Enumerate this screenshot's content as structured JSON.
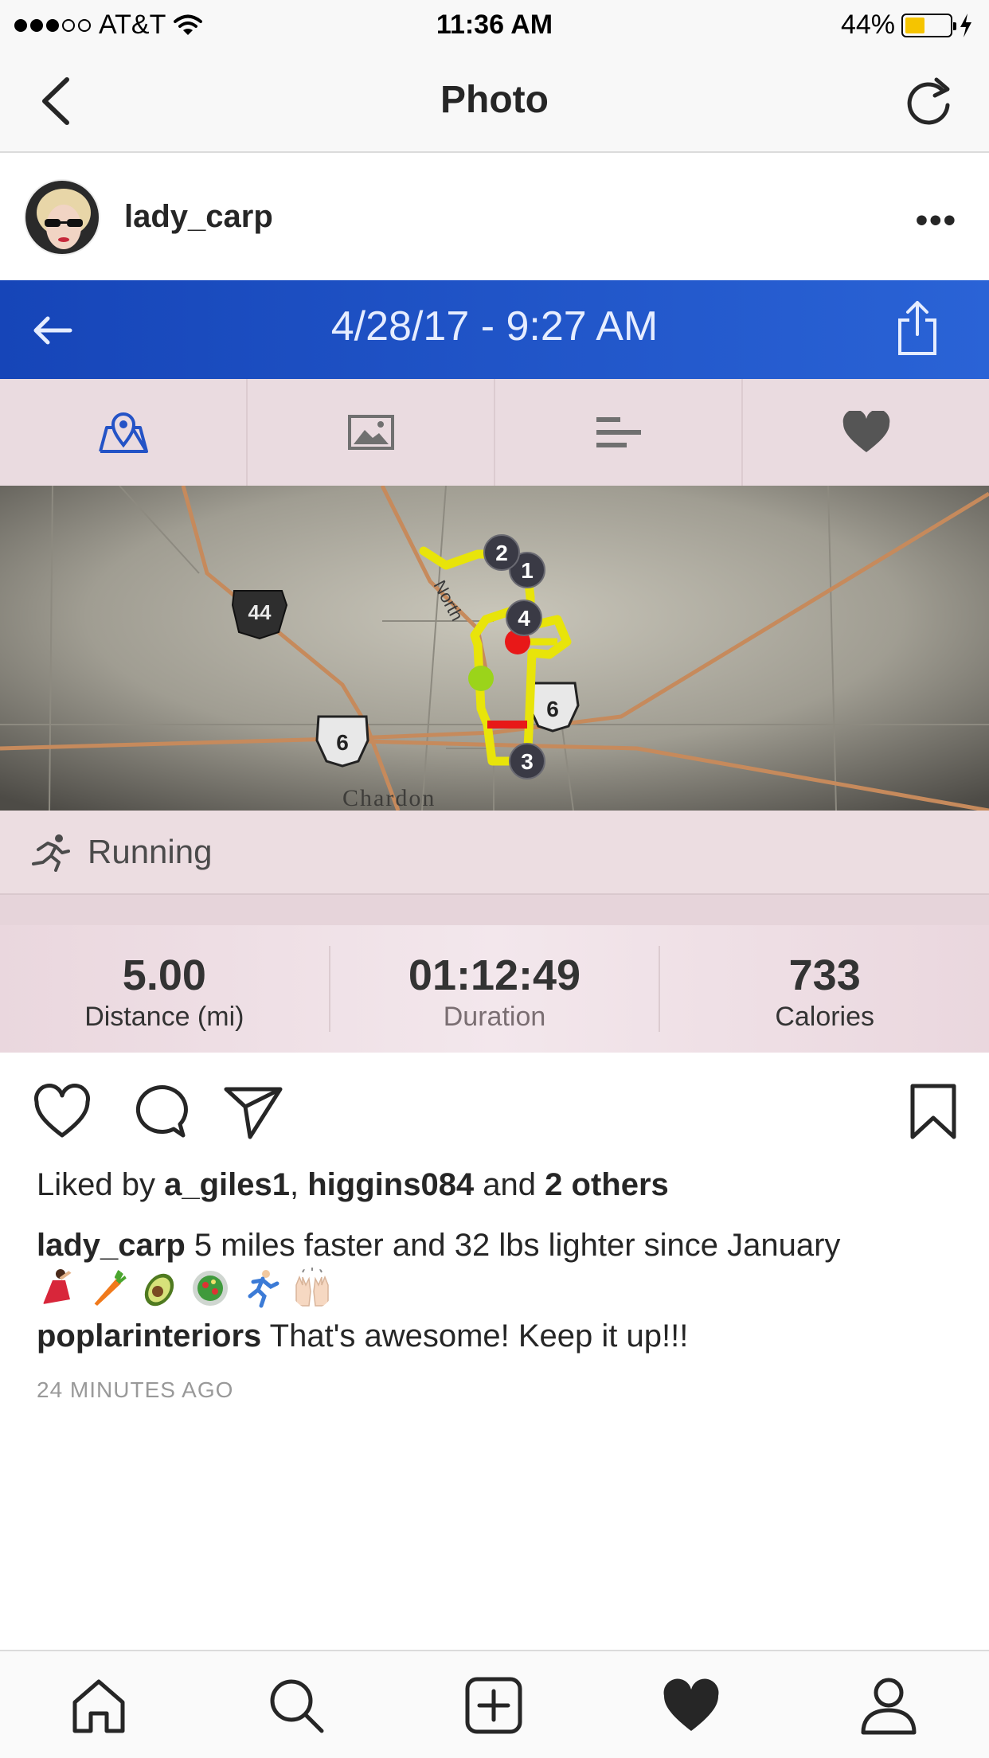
{
  "status_bar": {
    "carrier": "AT&T",
    "time": "11:36 AM",
    "battery_percent": "44%",
    "battery_level": 0.44,
    "signal_bars_filled": 3,
    "signal_bars_total": 5
  },
  "nav": {
    "title": "Photo",
    "back_icon": "chevron-left-icon",
    "refresh_icon": "refresh-icon"
  },
  "post": {
    "username": "lady_carp",
    "more_label": "•••"
  },
  "workout": {
    "datetime": "4/28/17 - 9:27 AM",
    "tabs": [
      "map-icon",
      "photo-icon",
      "bars-icon",
      "heart-icon"
    ],
    "map_labels": {
      "route_44": "44",
      "route_6": "6",
      "road": "North",
      "town": "Chardon",
      "markers": [
        "1",
        "2",
        "3",
        "4"
      ]
    },
    "activity": "Running",
    "stats": [
      {
        "value": "5.00",
        "label": "Distance (mi)"
      },
      {
        "value": "01:12:49",
        "label": "Duration"
      },
      {
        "value": "733",
        "label": "Calories"
      }
    ]
  },
  "engagement": {
    "liked_by_prefix": "Liked by ",
    "liker1": "a_giles1",
    "sep": ", ",
    "liker2": "higgins084",
    "and": " and ",
    "others": "2 others",
    "caption_user": "lady_carp",
    "caption_text": " 5 miles faster and 32 lbs lighter since January",
    "comment_user": "poplarinteriors",
    "comment_text": " That's awesome! Keep it up!!!",
    "time_ago": "24 MINUTES AGO"
  },
  "colors": {
    "app_blue": "#1645b8",
    "route_yellow": "#f2f20a",
    "route_red": "#e81818",
    "start_green": "#9bd41a",
    "battery_yellow": "#f5c400"
  }
}
